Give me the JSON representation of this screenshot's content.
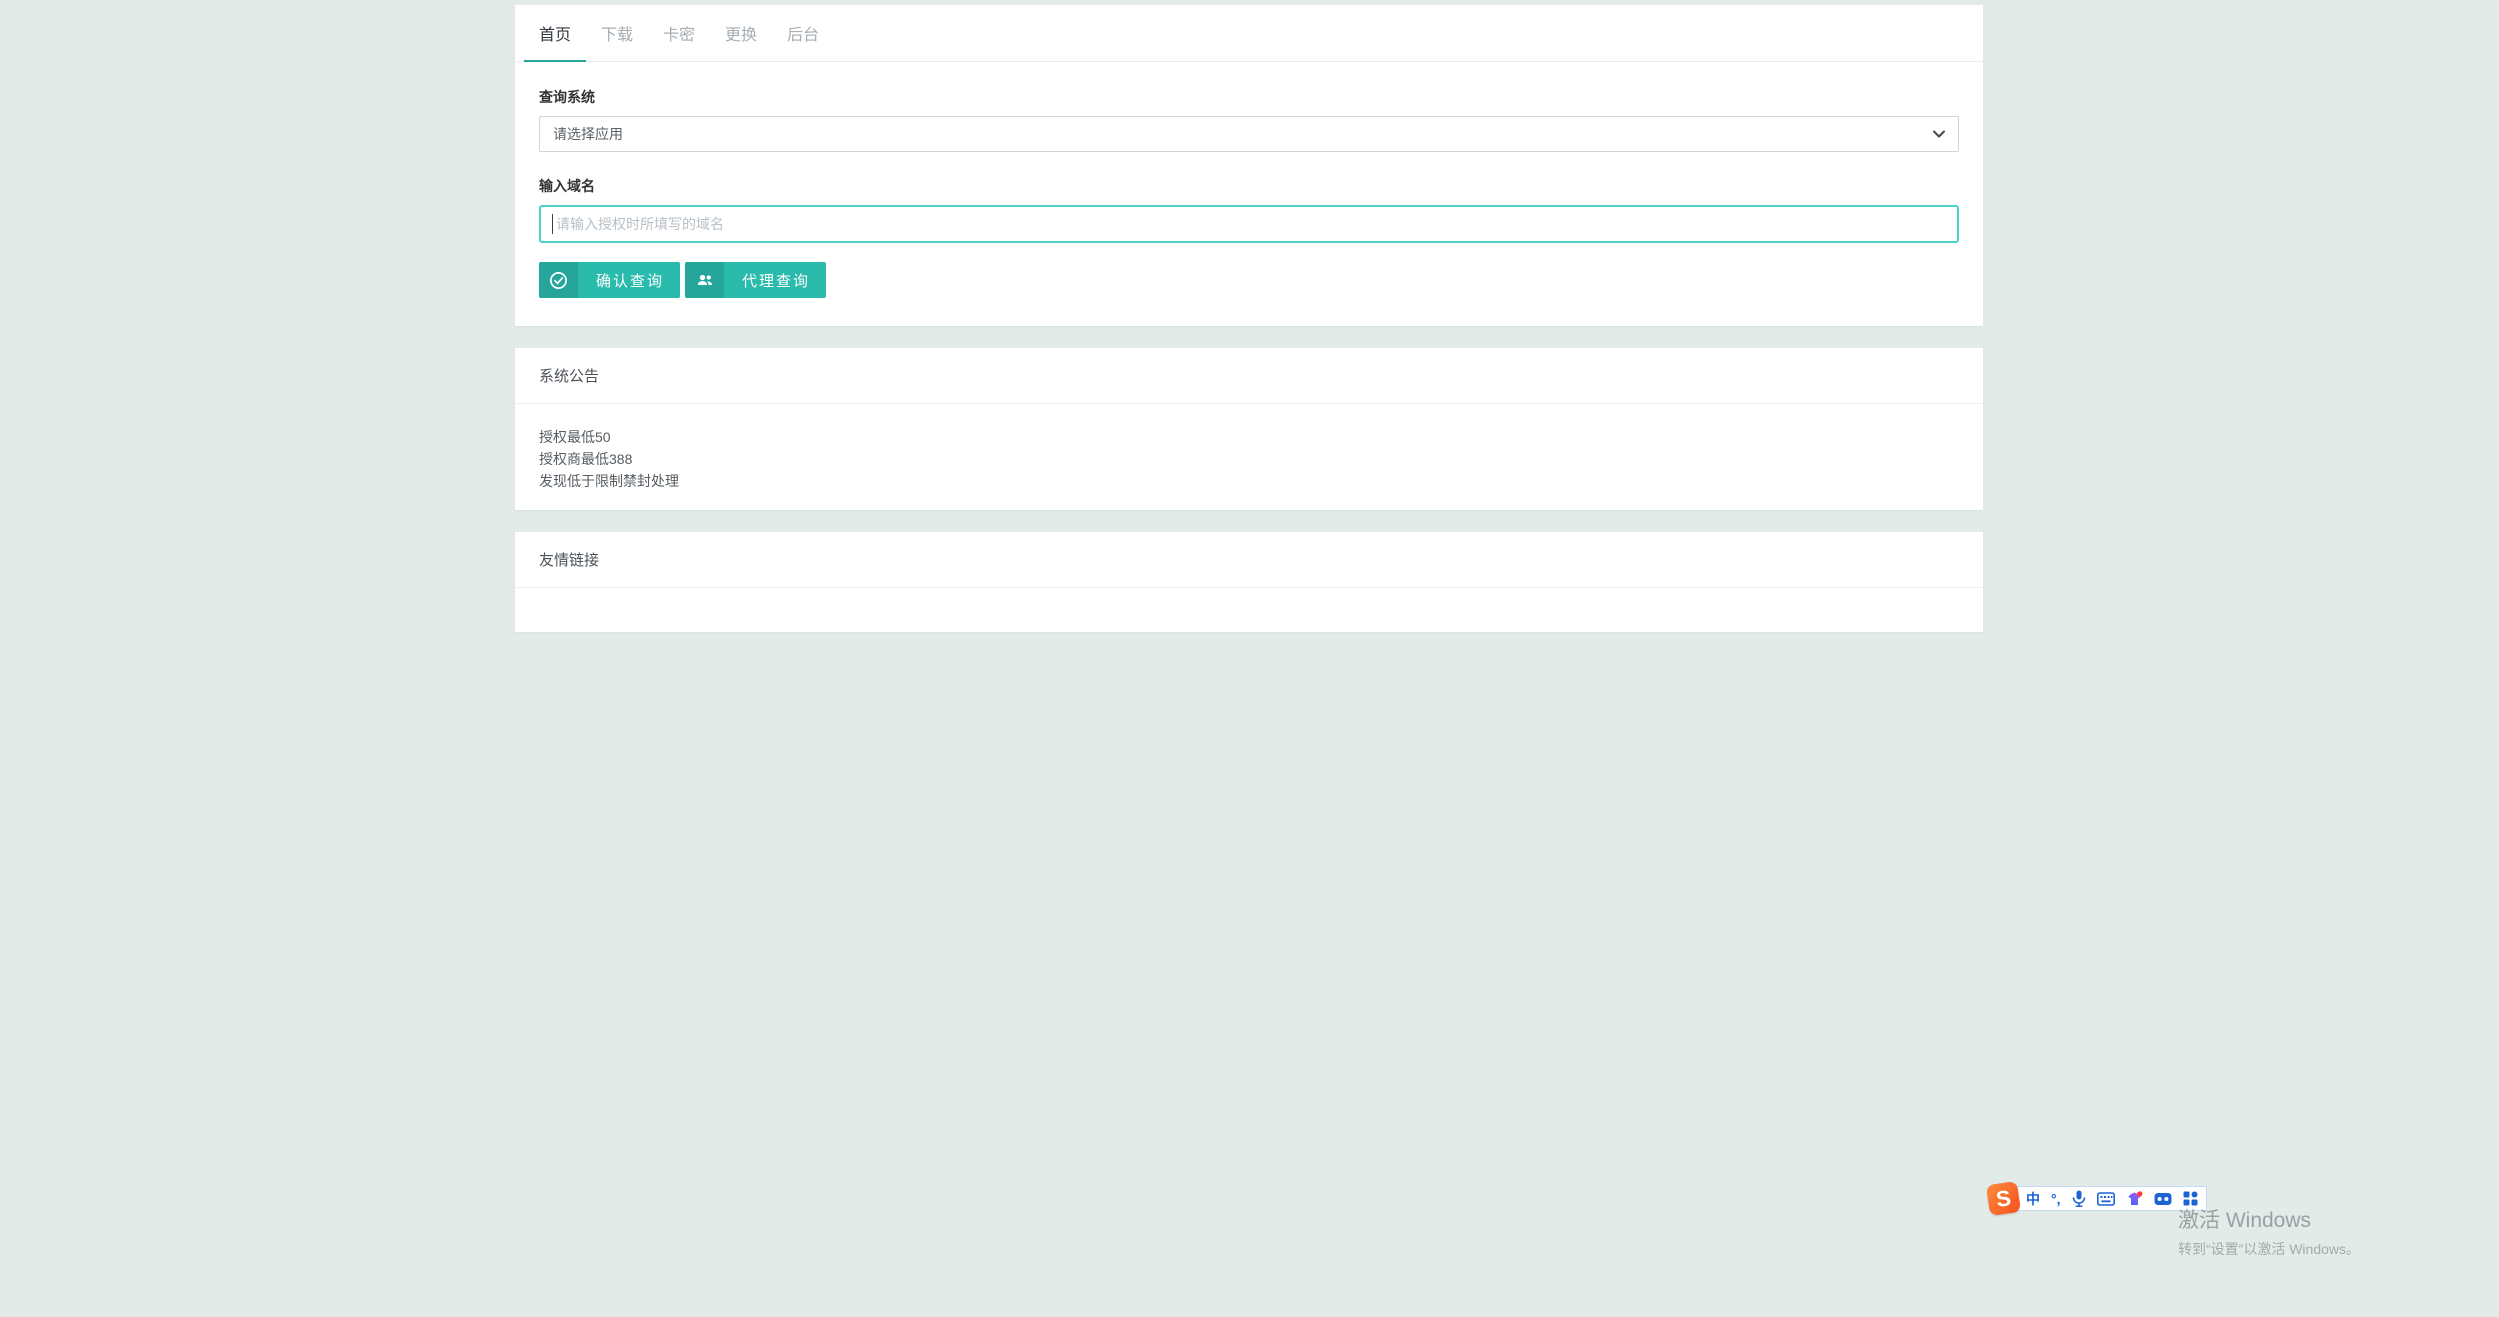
{
  "page": {
    "background": "#e3ebe9",
    "accent": "#2bbbad",
    "accent_dark": "#26a69a",
    "input_focus_border": "#4fd2c6"
  },
  "tabs": {
    "items": [
      {
        "label": "首页",
        "active": true
      },
      {
        "label": "下载",
        "active": false
      },
      {
        "label": "卡密",
        "active": false
      },
      {
        "label": "更换",
        "active": false
      },
      {
        "label": "后台",
        "active": false
      }
    ]
  },
  "query_form": {
    "system_label": "查询系统",
    "select_value": "请选择应用",
    "domain_label": "输入域名",
    "domain_placeholder": "请输入授权时所填写的域名",
    "domain_value": "",
    "confirm_button": "确认查询",
    "agent_button": "代理查询"
  },
  "announcement": {
    "title": "系统公告",
    "lines": [
      "授权最低50",
      "授权商最低388",
      "发现低于限制禁封处理"
    ]
  },
  "links": {
    "title": "友情链接"
  },
  "ime_toolbar": {
    "logo_letter": "S",
    "mode_label": "中",
    "punctuation_label": "°,",
    "icons": [
      "sogou-logo",
      "chinese-mode",
      "punctuation",
      "voice",
      "keyboard",
      "skin",
      "emoji",
      "toolbox"
    ]
  },
  "watermark": {
    "line1": "激活 Windows",
    "line2": "转到“设置”以激活 Windows。"
  }
}
